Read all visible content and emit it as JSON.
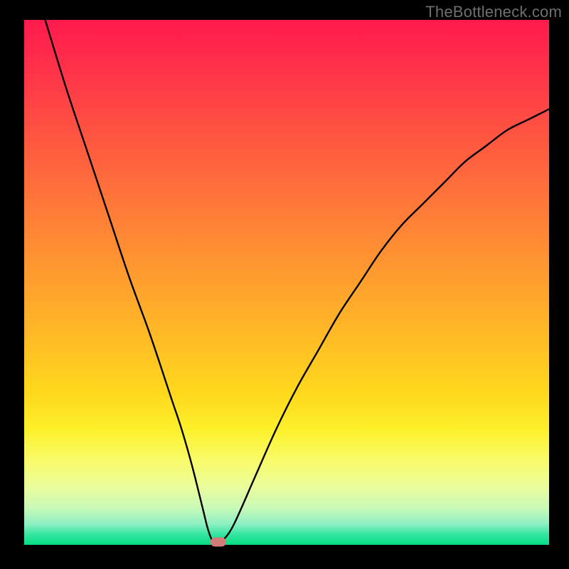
{
  "watermark": "TheBottleneck.com",
  "colors": {
    "gradient_top": "#ff1a4e",
    "gradient_bottom": "#06dd84",
    "curve": "#000000",
    "marker": "#d37a7a",
    "frame": "#000000"
  },
  "chart_data": {
    "type": "line",
    "title": "",
    "xlabel": "",
    "ylabel": "",
    "xlim": [
      0,
      100
    ],
    "ylim": [
      0,
      100
    ],
    "grid": false,
    "legend": false,
    "annotations": [],
    "series": [
      {
        "name": "bottleneck-curve",
        "x": [
          0,
          4,
          8,
          12,
          16,
          20,
          24,
          28,
          30,
          32,
          34,
          35,
          36,
          37,
          38,
          40,
          44,
          48,
          52,
          56,
          60,
          64,
          68,
          72,
          76,
          80,
          84,
          88,
          92,
          96,
          100
        ],
        "y": [
          113,
          100,
          87,
          75,
          63,
          51,
          40,
          28,
          22,
          15,
          7,
          3,
          0.5,
          0.5,
          1,
          4,
          13,
          22,
          30,
          37,
          44,
          50,
          56,
          61,
          65,
          69,
          73,
          76,
          79,
          81,
          83
        ]
      }
    ],
    "marker": {
      "x": 37,
      "y": 0.5
    }
  }
}
